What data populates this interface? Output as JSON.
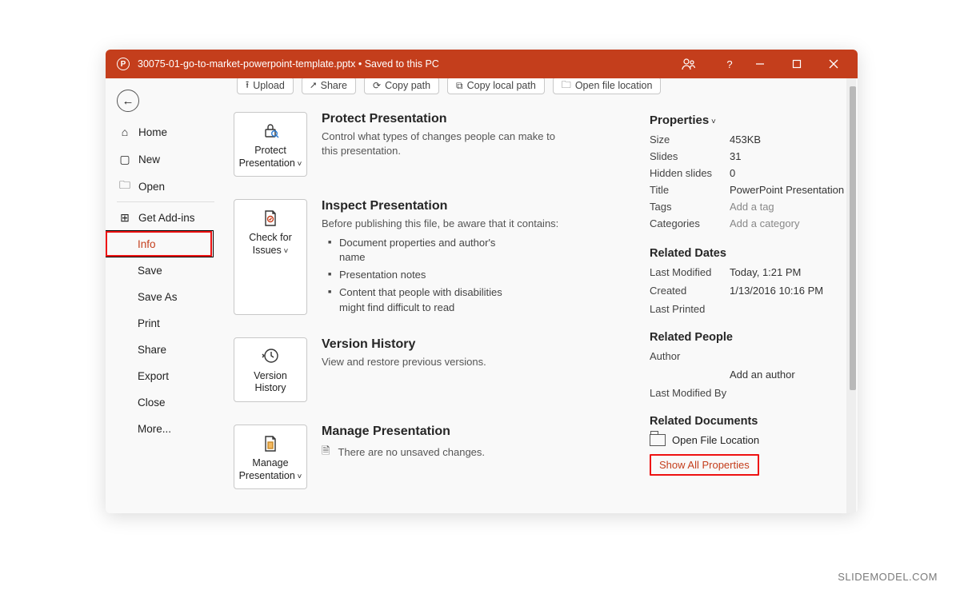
{
  "titlebar": {
    "filename": "30075-01-go-to-market-powerpoint-template.pptx",
    "separator": " • ",
    "status": "Saved to this PC"
  },
  "nav": {
    "home": "Home",
    "new": "New",
    "open": "Open",
    "getaddins": "Get Add-ins",
    "info": "Info",
    "save": "Save",
    "saveas": "Save As",
    "print": "Print",
    "share": "Share",
    "export": "Export",
    "close": "Close",
    "more": "More..."
  },
  "quickbar": {
    "upload": "Upload",
    "share": "Share",
    "copypath": "Copy path",
    "copylocalpath": "Copy local path",
    "openlocation": "Open file location"
  },
  "protect": {
    "btn": "Protect Presentation",
    "title": "Protect Presentation",
    "desc": "Control what types of changes people can make to this presentation."
  },
  "inspect": {
    "btn": "Check for Issues",
    "title": "Inspect Presentation",
    "lead": "Before publishing this file, be aware that it contains:",
    "b1": "Document properties and author's name",
    "b2": "Presentation notes",
    "b3": "Content that people with disabilities might find difficult to read"
  },
  "version": {
    "btn": "Version History",
    "title": "Version History",
    "desc": "View and restore previous versions."
  },
  "manage": {
    "btn": "Manage Presentation",
    "title": "Manage Presentation",
    "desc": "There are no unsaved changes."
  },
  "props": {
    "header": "Properties",
    "size_k": "Size",
    "size_v": "453KB",
    "slides_k": "Slides",
    "slides_v": "31",
    "hidden_k": "Hidden slides",
    "hidden_v": "0",
    "title_k": "Title",
    "title_v": "PowerPoint Presentation",
    "tags_k": "Tags",
    "tags_v": "Add a tag",
    "cats_k": "Categories",
    "cats_v": "Add a category"
  },
  "dates": {
    "header": "Related Dates",
    "lm_k": "Last Modified",
    "lm_v": "Today, 1:21 PM",
    "cr_k": "Created",
    "cr_v": "1/13/2016 10:16 PM",
    "lp_k": "Last Printed",
    "lp_v": ""
  },
  "people": {
    "header": "Related People",
    "author_k": "Author",
    "addauthor": "Add an author",
    "lmb_k": "Last Modified By"
  },
  "docs": {
    "header": "Related Documents",
    "openloc": "Open File Location",
    "showall": "Show All Properties"
  },
  "watermark": "SLIDEMODEL.COM"
}
